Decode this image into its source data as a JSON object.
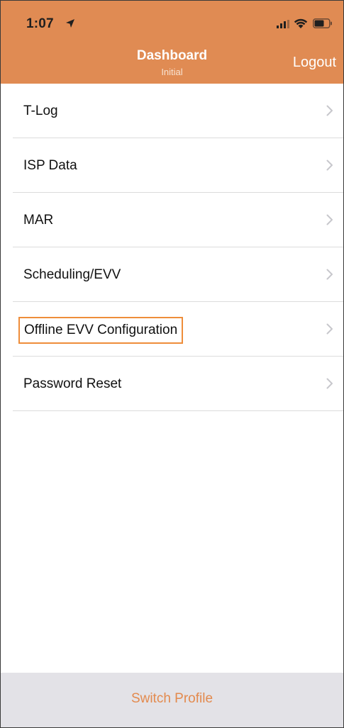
{
  "status_bar": {
    "time": "1:07"
  },
  "nav": {
    "title": "Dashboard",
    "subtitle": "Initial",
    "logout_label": "Logout"
  },
  "menu": {
    "items": [
      {
        "label": "T-Log"
      },
      {
        "label": "ISP Data"
      },
      {
        "label": "MAR"
      },
      {
        "label": "Scheduling/EVV"
      },
      {
        "label": "Offline EVV Configuration",
        "highlighted": true
      },
      {
        "label": "Password Reset"
      }
    ]
  },
  "footer": {
    "switch_profile_label": "Switch Profile"
  },
  "colors": {
    "brand": "#e08b53",
    "highlight_border": "#ee8d3a",
    "footer_bg": "#e3e2e7",
    "footer_text": "#e38a4e"
  },
  "icons": {
    "location": "location-arrow-icon",
    "signal": "cellular-signal-icon",
    "wifi": "wifi-icon",
    "battery": "battery-icon",
    "chevron": "chevron-right-icon"
  }
}
